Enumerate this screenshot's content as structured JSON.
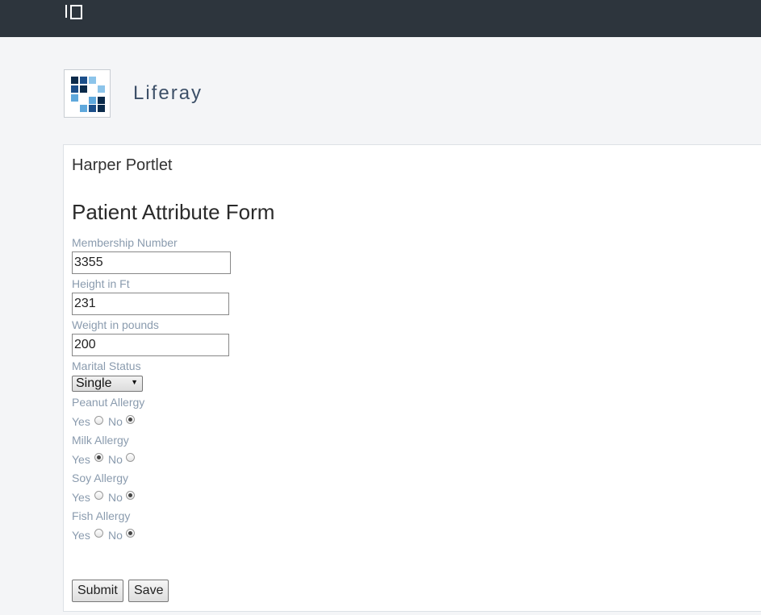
{
  "site": {
    "name": "Liferay"
  },
  "portlet": {
    "title": "Harper Portlet",
    "form_title": "Patient Attribute Form",
    "fields": {
      "membership": {
        "label": "Membership Number",
        "value": "3355"
      },
      "height": {
        "label": "Height in Ft",
        "value": "231"
      },
      "weight": {
        "label": "Weight in pounds",
        "value": "200"
      },
      "marital": {
        "label": "Marital Status",
        "value": "Single"
      }
    },
    "allergies": [
      {
        "label": "Peanut Allergy",
        "yes_label": "Yes",
        "no_label": "No",
        "selected": "no"
      },
      {
        "label": "Milk Allergy",
        "yes_label": "Yes",
        "no_label": "No",
        "selected": "yes"
      },
      {
        "label": "Soy Allergy",
        "yes_label": "Yes",
        "no_label": "No",
        "selected": "no"
      },
      {
        "label": "Fish Allergy",
        "yes_label": "Yes",
        "no_label": "No",
        "selected": "no"
      }
    ],
    "buttons": {
      "submit": "Submit",
      "save": "Save"
    }
  },
  "icons": {
    "sidebar_toggle": "sidebar-toggle-icon",
    "logo": "liferay-logo"
  },
  "colors": {
    "topbar": "#2d353d",
    "label": "#8a9bae",
    "site_name": "#3d5068"
  }
}
